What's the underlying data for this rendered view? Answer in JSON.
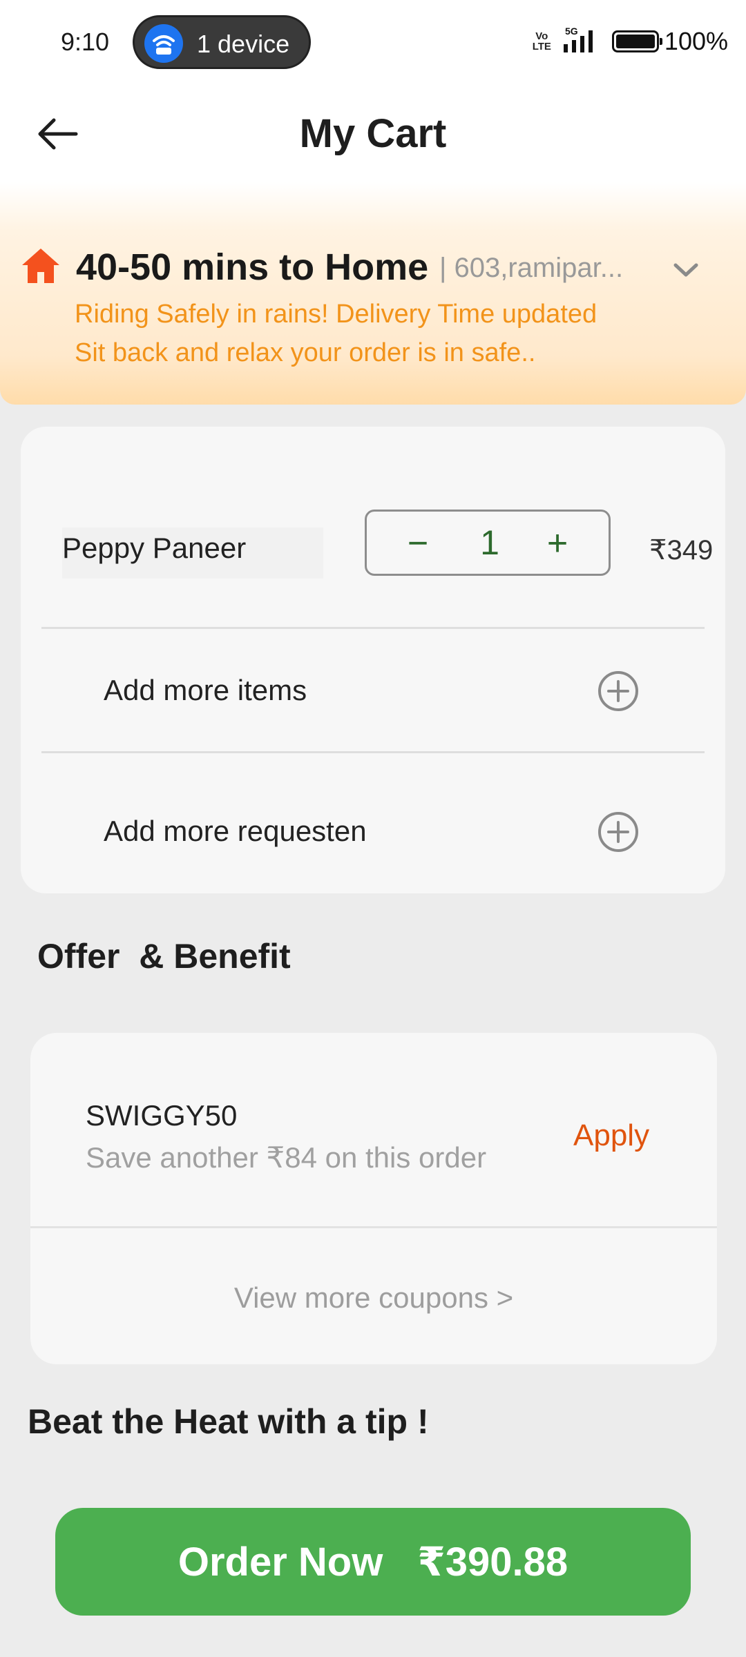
{
  "status_bar": {
    "time": "9:10",
    "hotspot_label": "1 device",
    "network_label_top": "Vo",
    "network_label_bottom": "LTE",
    "network_type": "5G",
    "battery": "100%"
  },
  "header": {
    "title": "My Cart"
  },
  "delivery": {
    "title": "40-50 mins to Home",
    "address": "| 603,ramipar...",
    "message_line1": "Riding Safely in rains! Delivery Time updated",
    "message_line2": "Sit back and relax your order is in safe..",
    "accent_color": "#f2931a",
    "home_icon_color": "#f4511e"
  },
  "cart": {
    "item": {
      "name": "Peppy Paneer",
      "quantity": "1",
      "minus": "−",
      "plus": "+",
      "price": "₹349"
    },
    "add_items_label": "Add more items",
    "add_requests_label": "Add more requesten"
  },
  "offers": {
    "section_title": "Offer  & Benefit",
    "coupon_code": "SWIGGY50",
    "coupon_desc": "Save another ₹84 on this order",
    "apply_label": "Apply",
    "view_more_label": "View more coupons >",
    "apply_color": "#e0540e"
  },
  "tip": {
    "section_title": "Beat the Heat with a tip !"
  },
  "order": {
    "label": "Order Now",
    "total": "₹390.88",
    "button_color": "#4caf50"
  },
  "icons": [
    "wifi-hotspot-icon",
    "signal-icon",
    "battery-icon",
    "back-arrow-icon",
    "home-icon",
    "chevron-down-icon",
    "add-circle-icon"
  ]
}
